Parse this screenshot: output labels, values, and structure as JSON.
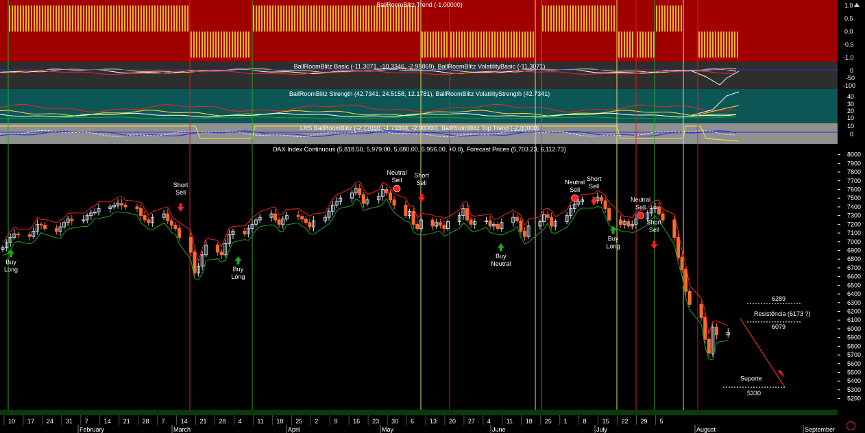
{
  "colors": {
    "trend_bg": "#a00000",
    "basic_bg": "#2e2e2e",
    "strength_bg": "#0c5656",
    "lrs_bg": "#909090",
    "price_bg": "#000000",
    "bull": "#cfd8df",
    "bear": "#ff6a2a",
    "upper": "#ff2020",
    "lower": "#1aa81a",
    "yellow": "#ffe033",
    "blue": "#2a34d8",
    "vline_red": "#e02020",
    "vline_green": "#2aa62a",
    "vline_yellow": "#e8e070"
  },
  "panels": {
    "trend": {
      "title": "BallRoomBlitz Trend (-1.00000)",
      "ticks": [
        "1.0",
        "0.5",
        "0.0",
        "-0.5",
        "-1.0"
      ]
    },
    "basic": {
      "title": "BallRoomBlitz Basic (-11.3071, -10.3346, -2.95869), BallRoomBlitz VolatilityBasic (-11.3071)",
      "ticks": [
        "0",
        "-50",
        "-100"
      ]
    },
    "strength": {
      "title": "BallRoomBlitz Strength (42.7341, 24.5158, 12.1781), BallRoomBlitz VolatilityStrength (42.7341)",
      "ticks": [
        "40",
        "30",
        "20",
        "10"
      ]
    },
    "lrs": {
      "title": "LRS BallRoomBlitz (-2.77030, -1.73394, -2.00000), BallRoomBlitz Top Trend (-2.00000)",
      "ticks": [
        "10",
        "0"
      ]
    },
    "price": {
      "title": "DAX Index Continuous (5,818.50, 5,979.00, 5,680.00, 5,956.00, +0.0), Forecast Prices (5,703.23, 6,112.73)"
    }
  },
  "chart_data": {
    "type": "candlestick",
    "instrument": "DAX Index Continuous",
    "y_ticks": [
      8000,
      7900,
      7800,
      7700,
      7600,
      7500,
      7400,
      7300,
      7200,
      7100,
      7000,
      6900,
      6800,
      6700,
      6600,
      6500,
      6400,
      6300,
      6200,
      6100,
      6000,
      5900,
      5800,
      5700,
      5600,
      5500,
      5400,
      5300,
      5200
    ],
    "ylim": [
      5150,
      8060
    ],
    "x_day_ticks": [
      "10",
      "17",
      "24",
      "31",
      "7",
      "14",
      "21",
      "28",
      "7",
      "14",
      "21",
      "28",
      "4",
      "11",
      "18",
      "25",
      "2",
      "9",
      "16",
      "23",
      "30",
      "6",
      "13",
      "20",
      "27",
      "4",
      "11",
      "18",
      "25",
      "1",
      "8",
      "15",
      "22",
      "29",
      "5"
    ],
    "x_months": [
      "February",
      "March",
      "April",
      "May",
      "June",
      "July",
      "August",
      "September"
    ],
    "closes": [
      6930,
      6990,
      7050,
      7090,
      7080,
      7060,
      7120,
      7200,
      7190,
      7150,
      7120,
      7170,
      7220,
      7260,
      7240,
      7250,
      7300,
      7330,
      7340,
      7380,
      7400,
      7420,
      7440,
      7420,
      7400,
      7380,
      7300,
      7250,
      7220,
      7280,
      7320,
      7240,
      7190,
      7150,
      7050,
      6880,
      6640,
      6720,
      6850,
      6960,
      6880,
      6850,
      6980,
      7080,
      7120,
      7090,
      7150,
      7200,
      7250,
      7280,
      7320,
      7250,
      7200,
      7260,
      7300,
      7290,
      7260,
      7220,
      7170,
      7240,
      7280,
      7350,
      7420,
      7460,
      7500,
      7560,
      7610,
      7540,
      7440,
      7480,
      7520,
      7600,
      7560,
      7480,
      7420,
      7300,
      7350,
      7200,
      7150,
      7250,
      7180,
      7220,
      7190,
      7150,
      7230,
      7300,
      7380,
      7250,
      7200,
      7230,
      7240,
      7180,
      7200,
      7150,
      7220,
      7280,
      7240,
      7120,
      7060,
      7180,
      7230,
      7310,
      7280,
      7180,
      7230,
      7300,
      7380,
      7430,
      7460,
      7480,
      7470,
      7510,
      7470,
      7380,
      7250,
      7200,
      7230,
      7180,
      7200,
      7260,
      7330,
      7380,
      7400,
      7320,
      7250,
      7050,
      6820,
      6680,
      6430,
      6280,
      6130,
      5880,
      5720,
      6020,
      5930,
      5956
    ],
    "forecast": {
      "start": 6112.73,
      "end": 5330
    },
    "levels": [
      {
        "label": "6289",
        "value": 6289
      },
      {
        "label": "Resistência (6173 ?)",
        "value": 6173
      },
      {
        "label": "6079",
        "value": 6079
      },
      {
        "label": "Suporte",
        "value": 5430
      },
      {
        "label": "5330",
        "value": 5330
      }
    ],
    "signals": [
      {
        "label": "Buy Long",
        "day": 3,
        "price": 6930,
        "side": "buy"
      },
      {
        "label": "Short Sell",
        "day": 65,
        "price": 7330,
        "side": "sell"
      },
      {
        "label": "Buy Long",
        "day": 86,
        "price": 6850,
        "side": "buy"
      },
      {
        "label": "Neutral Sell",
        "day": 144,
        "price": 7610,
        "side": "neutral"
      },
      {
        "label": "Short Sell",
        "day": 153,
        "price": 7440,
        "side": "sell"
      },
      {
        "label": "Buy Neutral",
        "day": 182,
        "price": 7000,
        "side": "buy"
      },
      {
        "label": "Neutral Sell",
        "day": 209,
        "price": 7500,
        "side": "neutral"
      },
      {
        "label": "Short Sell",
        "day": 216,
        "price": 7400,
        "side": "sell"
      },
      {
        "label": "Buy Long",
        "day": 223,
        "price": 7200,
        "side": "buy"
      },
      {
        "label": "Neutral Sell",
        "day": 233,
        "price": 7300,
        "side": "neutral"
      },
      {
        "label": "Short Sell",
        "day": 238,
        "price": 6900,
        "side": "sell"
      }
    ]
  }
}
